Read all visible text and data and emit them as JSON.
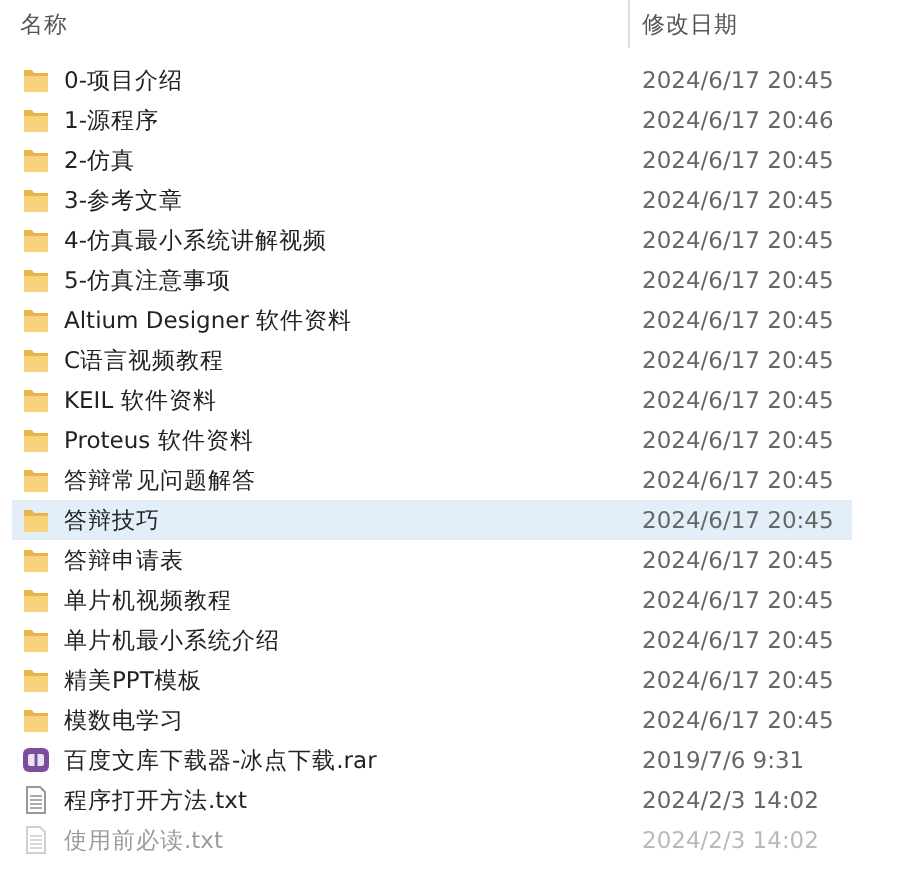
{
  "columns": [
    {
      "label": "名称"
    },
    {
      "label": "修改日期"
    }
  ],
  "rows": [
    {
      "name": "0-项目介绍",
      "date": "2024/6/17 20:45",
      "kind": "folder",
      "selected": false,
      "hidden": false
    },
    {
      "name": "1-源程序",
      "date": "2024/6/17 20:46",
      "kind": "folder",
      "selected": false,
      "hidden": false
    },
    {
      "name": "2-仿真",
      "date": "2024/6/17 20:45",
      "kind": "folder",
      "selected": false,
      "hidden": false
    },
    {
      "name": "3-参考文章",
      "date": "2024/6/17 20:45",
      "kind": "folder",
      "selected": false,
      "hidden": false
    },
    {
      "name": "4-仿真最小系统讲解视频",
      "date": "2024/6/17 20:45",
      "kind": "folder",
      "selected": false,
      "hidden": false
    },
    {
      "name": "5-仿真注意事项",
      "date": "2024/6/17 20:45",
      "kind": "folder",
      "selected": false,
      "hidden": false
    },
    {
      "name": "Altium Designer 软件资料",
      "date": "2024/6/17 20:45",
      "kind": "folder",
      "selected": false,
      "hidden": false
    },
    {
      "name": "C语言视频教程",
      "date": "2024/6/17 20:45",
      "kind": "folder",
      "selected": false,
      "hidden": false
    },
    {
      "name": "KEIL 软件资料",
      "date": "2024/6/17 20:45",
      "kind": "folder",
      "selected": false,
      "hidden": false
    },
    {
      "name": "Proteus 软件资料",
      "date": "2024/6/17 20:45",
      "kind": "folder",
      "selected": false,
      "hidden": false
    },
    {
      "name": "答辩常见问题解答",
      "date": "2024/6/17 20:45",
      "kind": "folder",
      "selected": false,
      "hidden": false
    },
    {
      "name": "答辩技巧",
      "date": "2024/6/17 20:45",
      "kind": "folder",
      "selected": true,
      "hidden": false
    },
    {
      "name": "答辩申请表",
      "date": "2024/6/17 20:45",
      "kind": "folder",
      "selected": false,
      "hidden": false
    },
    {
      "name": "单片机视频教程",
      "date": "2024/6/17 20:45",
      "kind": "folder",
      "selected": false,
      "hidden": false
    },
    {
      "name": "单片机最小系统介绍",
      "date": "2024/6/17 20:45",
      "kind": "folder",
      "selected": false,
      "hidden": false
    },
    {
      "name": "精美PPT模板",
      "date": "2024/6/17 20:45",
      "kind": "folder",
      "selected": false,
      "hidden": false
    },
    {
      "name": "模数电学习",
      "date": "2024/6/17 20:45",
      "kind": "folder",
      "selected": false,
      "hidden": false
    },
    {
      "name": "百度文库下载器-冰点下载.rar",
      "date": "2019/7/6 9:31",
      "kind": "archive",
      "selected": false,
      "hidden": false
    },
    {
      "name": "程序打开方法.txt",
      "date": "2024/2/3 14:02",
      "kind": "text",
      "selected": false,
      "hidden": false
    },
    {
      "name": "使用前必读.txt",
      "date": "2024/2/3 14:02",
      "kind": "text",
      "selected": false,
      "hidden": true
    }
  ]
}
